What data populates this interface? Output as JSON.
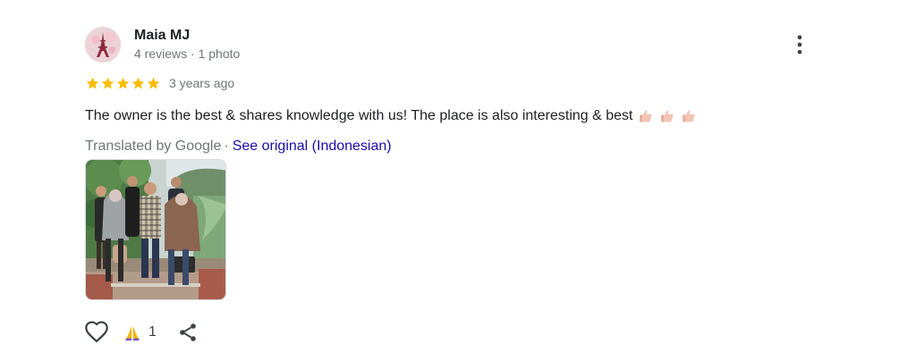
{
  "author": {
    "name": "Maia MJ",
    "meta": "4 reviews · 1 photo",
    "avatar_icon": "eiffel-tower-avatar"
  },
  "rating": {
    "stars": 5,
    "max": 5,
    "date": "3 years ago",
    "star_color": "#fbbc04"
  },
  "review": {
    "text": "The owner is the best & shares knowledge with us! The place is also interesting & best",
    "emoji_icons": [
      "thumbs-up-icon",
      "thumbs-up-icon",
      "thumbs-up-icon"
    ]
  },
  "translation": {
    "label": "Translated by Google",
    "separator": "·",
    "link": "See original (Indonesian)",
    "link_color": "#1a0dab"
  },
  "photo": {
    "description_icon": "group-photo"
  },
  "actions": {
    "like_icon": "heart-outline-icon",
    "reaction_icon": "folded-hands-icon",
    "reaction_count": "1",
    "share_icon": "share-icon"
  },
  "menu": {
    "icon": "more-vert-icon"
  }
}
